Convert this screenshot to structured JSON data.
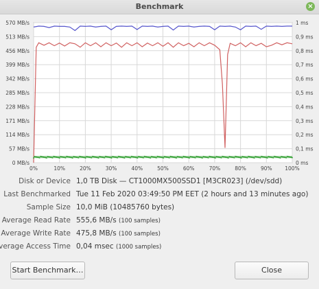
{
  "window": {
    "title": "Benchmark"
  },
  "chart_data": {
    "type": "line",
    "x_ticks": [
      "0%",
      "10%",
      "20%",
      "30%",
      "40%",
      "50%",
      "60%",
      "70%",
      "80%",
      "90%",
      "100%"
    ],
    "y_left_ticks": [
      "0 MB/s",
      "57 MB/s",
      "114 MB/s",
      "171 MB/s",
      "228 MB/s",
      "285 MB/s",
      "342 MB/s",
      "399 MB/s",
      "456 MB/s",
      "513 MB/s",
      "570 MB/s"
    ],
    "y_right_ticks": [
      "0 ms",
      "0,1 ms",
      "0,2 ms",
      "0,3 ms",
      "0,4 ms",
      "0,5 ms",
      "0,6 ms",
      "0,7 ms",
      "0,8 ms",
      "0,9 ms",
      "1 ms"
    ],
    "ylim_left": [
      0,
      570
    ],
    "ylim_right": [
      0,
      1
    ],
    "xlim": [
      0,
      100
    ],
    "grid": true,
    "series": [
      {
        "color": "#5555cc",
        "axis": "left",
        "x": [
          0,
          2,
          4,
          6,
          8,
          10,
          12,
          14,
          16,
          18,
          20,
          22,
          24,
          26,
          28,
          30,
          32,
          34,
          36,
          38,
          40,
          42,
          44,
          46,
          48,
          50,
          52,
          54,
          56,
          58,
          60,
          62,
          64,
          66,
          68,
          70,
          72,
          74,
          76,
          78,
          80,
          82,
          84,
          86,
          88,
          90,
          92,
          94,
          96,
          98,
          100
        ],
        "y": [
          552,
          556,
          555,
          550,
          556,
          555,
          555,
          552,
          538,
          556,
          555,
          556,
          552,
          555,
          556,
          541,
          555,
          556,
          555,
          556,
          542,
          556,
          555,
          556,
          552,
          555,
          556,
          540,
          556,
          555,
          556,
          552,
          555,
          556,
          555,
          541,
          556,
          555,
          556,
          552,
          541,
          556,
          555,
          556,
          543,
          556,
          555,
          556,
          555,
          556,
          556
        ]
      },
      {
        "color": "#d06060",
        "axis": "left",
        "x": [
          0,
          1,
          2,
          4,
          6,
          8,
          10,
          12,
          14,
          16,
          18,
          20,
          22,
          24,
          26,
          28,
          30,
          32,
          34,
          36,
          38,
          40,
          42,
          44,
          46,
          48,
          50,
          52,
          54,
          56,
          58,
          60,
          62,
          64,
          66,
          68,
          70,
          72,
          73,
          74,
          75,
          76,
          78,
          80,
          82,
          84,
          86,
          88,
          90,
          92,
          94,
          96,
          98,
          100
        ],
        "y": [
          0,
          470,
          488,
          478,
          488,
          476,
          487,
          475,
          488,
          484,
          470,
          488,
          476,
          488,
          472,
          488,
          476,
          487,
          470,
          488,
          476,
          488,
          472,
          487,
          476,
          488,
          474,
          488,
          470,
          488,
          476,
          486,
          472,
          488,
          476,
          488,
          478,
          460,
          320,
          60,
          440,
          486,
          476,
          488,
          472,
          488,
          476,
          486,
          472,
          478,
          488,
          480,
          488,
          484
        ]
      },
      {
        "color": "#2f9e2f",
        "axis": "right",
        "x": [
          0,
          10,
          20,
          30,
          40,
          50,
          60,
          70,
          80,
          90,
          100
        ],
        "y": [
          0.04,
          0.04,
          0.04,
          0.04,
          0.04,
          0.04,
          0.04,
          0.04,
          0.04,
          0.04,
          0.04
        ]
      }
    ]
  },
  "info": [
    {
      "label": "Disk or Device",
      "value": "1,0 TB Disk — CT1000MX500SSD1 [M3CR023] (/dev/sdd)",
      "small": ""
    },
    {
      "label": "Last Benchmarked",
      "value": "Tue 11 Feb 2020 03:49:50 PM EET (2 hours and 13 minutes ago)",
      "small": ""
    },
    {
      "label": "Sample Size",
      "value": "10,0 MiB (10485760 bytes)",
      "small": ""
    },
    {
      "label": "Average Read Rate",
      "value": "555,6 MB/s",
      "small": "(100 samples)"
    },
    {
      "label": "Average Write Rate",
      "value": "475,8 MB/s",
      "small": "(100 samples)"
    },
    {
      "label": "Average Access Time",
      "value": "0,04 msec",
      "small": "(1000 samples)"
    }
  ],
  "buttons": {
    "start": "Start Benchmark…",
    "close": "Close"
  }
}
